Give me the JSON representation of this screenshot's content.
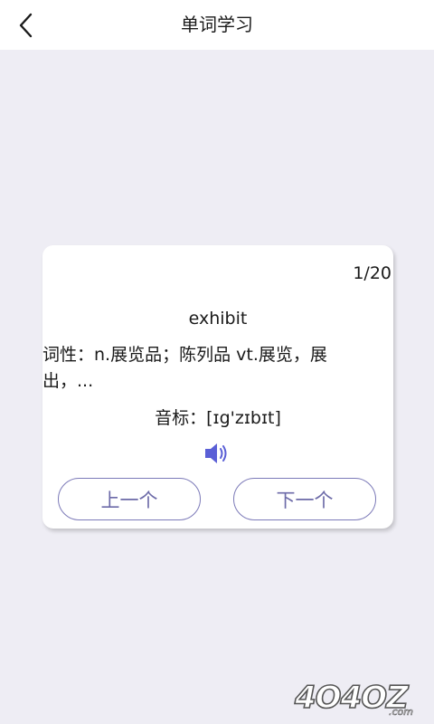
{
  "header": {
    "title": "单词学习",
    "back_icon": "chevron-left-icon"
  },
  "card": {
    "counter": "1/20",
    "word": "exhibit",
    "definition": "词性：n.展览品；陈列品 vt.展览，展出，...",
    "phonetic": "音标：[ɪg'zɪbɪt]",
    "speaker_icon": "speaker-icon",
    "speaker_color": "#5a5fd6",
    "prev_label": "上一个",
    "next_label": "下一个",
    "button_border_color": "#7c7ab8"
  },
  "watermark": {
    "text": "4O4OZ",
    "suffix": ".com"
  },
  "colors": {
    "background": "#eeedf4",
    "header": "#ffffff",
    "card": "#ffffff"
  }
}
